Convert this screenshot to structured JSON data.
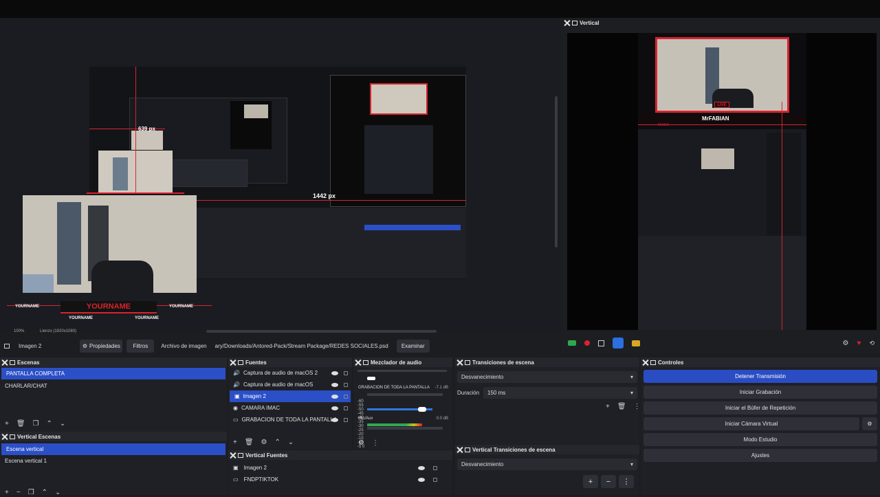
{
  "preview": {
    "measure_top": "639 px",
    "measure_right": "1442 px",
    "overlay_name": "YOURNAME",
    "overlay_handles": [
      "YOURNAME",
      "YOURNAME",
      "YOURNAME",
      "YOURNAME"
    ],
    "zoom": "100%",
    "canvas_label": "Lienzo (1920x1080)"
  },
  "vertical": {
    "title": "Vertical",
    "live_badge": "LIVE",
    "name_banner": "MrFABIAN",
    "side_label": "MUSIC"
  },
  "source_toolbar": {
    "source_name": "Imagen 2",
    "properties_label": "Propiedades",
    "filters_label": "Filtros",
    "file_label": "Archivo de imagen",
    "file_path": "ary/Downloads/Antored-Pack/Stream Package/REDES SOCIALES.psd",
    "browse_label": "Examinar"
  },
  "scenes": {
    "title": "Escenas",
    "items": [
      "PANTALLA COMPLETA",
      "CHARLAR/CHAT"
    ]
  },
  "vertical_scenes": {
    "title": "Vertical Escenas",
    "items": [
      "Escena vertical",
      "Escena vertical 1"
    ]
  },
  "sources": {
    "title": "Fuentes",
    "items": [
      "Captura de audio de macOS 2",
      "Captura de audio de macOS",
      "Imagen 2",
      "CAMARA IMAC",
      "GRABACION DE TODA LA PANTALLA"
    ]
  },
  "vertical_sources": {
    "title": "Vertical Fuentes",
    "items": [
      "Imagen 2",
      "FNDPTIKTOK"
    ]
  },
  "mixer": {
    "title": "Mezclador de audio",
    "scale": "-60 -55 -50 -45 -40 -35 -30 -25 -20 -15 -10 -5 0",
    "channels": [
      {
        "name": "GRABACION DE TODA LA PANTALLA",
        "level": "-7.1 dB"
      },
      {
        "name": "Mic/Aux",
        "level": "0.0 dB"
      }
    ]
  },
  "transitions": {
    "title": "Transiciones de escena",
    "selected": "Desvanecimiento",
    "duration_label": "Duración",
    "duration_value": "150 ms"
  },
  "vertical_transitions": {
    "title": "Vertical Transiciones de escena",
    "selected": "Desvanecimiento"
  },
  "controls": {
    "title": "Controles",
    "buttons": [
      "Detener Transmisión",
      "Iniciar Grabación",
      "Iniciar el Búfer de Repetición",
      "Iniciar Cámara Virtual",
      "Modo Estudio",
      "Ajustes"
    ]
  },
  "colors": {
    "accent": "#2b4fc7",
    "brand_red": "#d8232f",
    "panel_bg": "#1f2025"
  }
}
